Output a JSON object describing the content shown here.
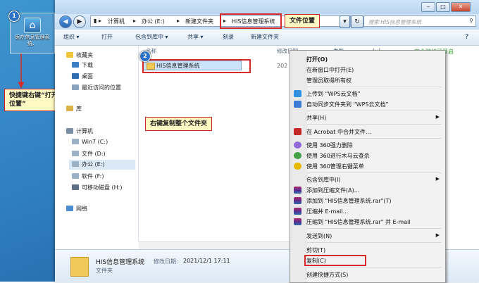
{
  "desktop": {
    "icon_label": "医疗信息管理系统、",
    "badge1": "1",
    "annotation1": "快捷键右键“打开文件位置”"
  },
  "window": {
    "breadcrumb": [
      "计算机",
      "办公 (E:)",
      "新建文件夹",
      "HIS信息管理系统"
    ],
    "search_placeholder": "搜索 HIS信息管理系统",
    "toolbar": [
      "组织 ▾",
      "打开",
      "包含到库中 ▾",
      "共享 ▾",
      "刻录",
      "新建文件夹"
    ],
    "columns": [
      "名称",
      "修改日期",
      "类型",
      "大小"
    ],
    "file_name": "HIS信息管理系统",
    "file_date_partial": "202",
    "status_text": "安全防护已开启",
    "details": {
      "name": "HIS信息管理系统",
      "modified_label": "修改日期:",
      "modified_value": "2021/12/1 17:11",
      "type": "文件夹"
    }
  },
  "sidebar": {
    "favorites": "收藏夹",
    "items_fav": [
      "下载",
      "桌面",
      "最近访问的位置"
    ],
    "library": "库",
    "computer": "计算机",
    "drives": [
      "Win7 (C:)",
      "文件 (D:)",
      "办公 (E:)",
      "软件 (F:)",
      "可移动磁盘 (H:)"
    ],
    "network": "网络"
  },
  "annotations": {
    "file_location": "文件位置",
    "badge2": "2",
    "copy_folder": "右键复制整个文件夹"
  },
  "menu": {
    "open": "打开(O)",
    "open_new_window": "在新窗口中打开(E)",
    "admin_ownership": "管理员取得所有权",
    "upload_wps": "上传到 “WPS云文档”",
    "sync_wps": "自动同步文件夹到 “WPS云文档”",
    "share": "共享(H)",
    "acrobat": "在 Acrobat 中合并文件...",
    "force_delete": "使用 360强力删除",
    "scan_trojan": "使用 360进行木马云查杀",
    "manage_menu": "使用 360管理右键菜单",
    "include_library": "包含到库中(I)",
    "add_archive": "添加到压缩文件(A)...",
    "add_rar": "添加到 \"HIS信息管理系统.rar\"(T)",
    "zip_email": "压缩并 E-mail...",
    "rar_email": "压缩到 \"HIS信息管理系统.rar\" 并 E-mail",
    "send_to": "发送到(N)",
    "cut": "剪切(T)",
    "copy": "复制(C)",
    "create_shortcut": "创建快捷方式(S)"
  },
  "colors": {
    "highlight_red": "#d62b2b",
    "note_bg": "#fff9c4",
    "selection_blue": "#cce4fb"
  }
}
